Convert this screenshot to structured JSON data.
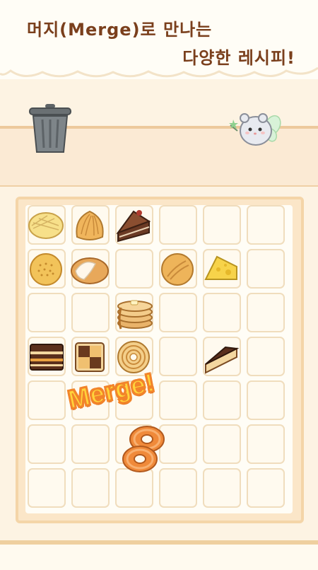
{
  "headline": {
    "line1": "머지(Merge)로 만나는",
    "line2": "다양한 레시피!"
  },
  "effect": {
    "merge_label": "Merge!"
  },
  "board": {
    "columns": 6,
    "rows": 7,
    "items": [
      {
        "row": 0,
        "col": 0,
        "name": "melon-bread"
      },
      {
        "row": 0,
        "col": 1,
        "name": "madeleine"
      },
      {
        "row": 0,
        "col": 2,
        "name": "chocolate-cake-slice"
      },
      {
        "row": 1,
        "col": 0,
        "name": "round-cookie"
      },
      {
        "row": 1,
        "col": 1,
        "name": "cream-bun"
      },
      {
        "row": 1,
        "col": 3,
        "name": "round-bread"
      },
      {
        "row": 1,
        "col": 4,
        "name": "cheese-wedge"
      },
      {
        "row": 2,
        "col": 2,
        "name": "pancake-stack"
      },
      {
        "row": 3,
        "col": 0,
        "name": "layer-cake"
      },
      {
        "row": 3,
        "col": 1,
        "name": "checker-cookie"
      },
      {
        "row": 3,
        "col": 2,
        "name": "baumkuchen"
      },
      {
        "row": 3,
        "col": 4,
        "name": "cheesecake-slice"
      },
      {
        "row": 5,
        "col": 2,
        "name": "glazed-donut"
      }
    ]
  },
  "colors": {
    "headline": "#7a3f1c",
    "merge_fill": "#ffd43b",
    "merge_outline": "#f2842a"
  }
}
